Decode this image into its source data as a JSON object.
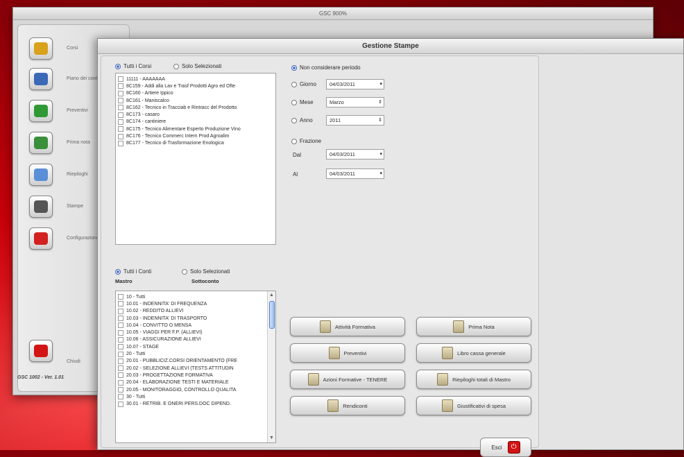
{
  "back_window": {
    "title": "GSC 900%",
    "sidebar": [
      {
        "label": "Corsi",
        "icon": "people-icon",
        "color": "#d9a21c"
      },
      {
        "label": "Piano dei conti",
        "icon": "printer-icon",
        "color": "#3b69b8"
      },
      {
        "label": "Preventivi",
        "icon": "money-icon",
        "color": "#2f9a35"
      },
      {
        "label": "Prima nota",
        "icon": "notebook-icon",
        "color": "#3a8f3a"
      },
      {
        "label": "Riepiloghi",
        "icon": "tools-icon",
        "color": "#5a8ed6"
      },
      {
        "label": "Stampe",
        "icon": "printer-icon",
        "color": "#555555"
      },
      {
        "label": "Configurazione",
        "icon": "apple-icon",
        "color": "#d32020"
      }
    ],
    "exit_label": "Chiudi",
    "footer": "GSC 1002 - Ver. 1.01"
  },
  "dialog": {
    "title": "Gestione Stampe",
    "courses": {
      "radio_all": "Tutti i Corsi",
      "radio_selected": "Solo Selezionati",
      "items": [
        "11111 - AAAAAAA",
        "8C159 - Addi alla Lav e Trasf Prodotti Agro ed Ofte",
        "8C160 - Artiere Ippico",
        "8C161 - Maniscalco",
        "8C162 - Tecnico in Tracciab e Rintracc del Prodotto",
        "8C173 - casaro",
        "8C174 - cantiniere",
        "8C175 - Tecnico Alimentare Esperto Produzione Vino",
        "8C176 - Tecnico Commerc Intern Prod Agroalim",
        "8C177 - Tecnico di Trasformazione Enologica"
      ]
    },
    "accounts": {
      "radio_all": "Tutti i Conti",
      "radio_selected": "Solo Selezionati",
      "col_master": "Mastro",
      "col_sub": "Sottoconto",
      "items": [
        "10 - Tutti",
        "10.01 - INDENNITA' DI FREQUENZA",
        "10.02 - REDDITO ALLIEVI",
        "10.03 - INDENNITA' DI TRASPORTO",
        "10.04 - CONVITTO O MENSA",
        "10.05 - VIAGGI PER F.P. (ALLIEVI)",
        "10.06 - ASSICURAZIONE ALLIEVI",
        "10.07 - STAGE",
        "20 - Tutti",
        "20.01 - PUBBLICIZ.CORSI ORIENTAMENTO (FRE",
        "20.02 - SELEZIONE ALLIEVI (TESTS ATTITUDIN",
        "20.03 - PROGETTAZIONE FORMATIVA",
        "20.04 - ELABORAZIONE TESTI E MATERIALE",
        "20.05 - MONITORAGGIO, CONTROLLO QUALITA",
        "30 - Tutti",
        "30.01 - RETRIB. E ONERI PERS.DOC DIPEND."
      ]
    },
    "period": {
      "none_label": "Non considerare periodo",
      "day_label": "Giorno",
      "day_value": "04/03/2011",
      "month_label": "Mese",
      "month_value": "Marzo",
      "year_label": "Anno",
      "year_value": "2011",
      "fraction_label": "Frazione",
      "from_label": "Dal",
      "from_value": "04/03/2011",
      "to_label": "Al",
      "to_value": "04/03/2011"
    },
    "buttons": [
      "Attività Formativa",
      "Prima Nota",
      "Preventivi",
      "Libro cassa generale",
      "Azioni Formative - TENERE",
      "Riepiloghi totali di Mastro",
      "Rendiconti",
      "Giustificativi di spesa"
    ],
    "exit_label": "Esci"
  },
  "colors": {
    "accent_red": "#c8000a",
    "selection_blue": "#3b5fae"
  }
}
